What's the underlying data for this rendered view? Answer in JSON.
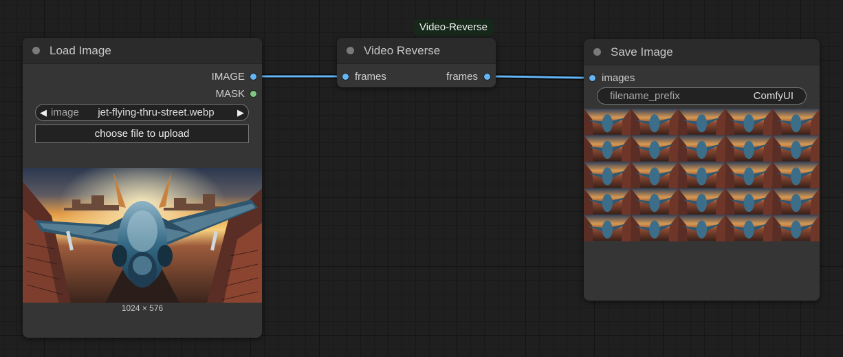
{
  "canvas": {
    "badge": "Video-Reverse"
  },
  "load_image": {
    "title": "Load Image",
    "outputs": [
      "IMAGE",
      "MASK"
    ],
    "image_widget": {
      "name": "image",
      "value": "jet-flying-thru-street.webp"
    },
    "upload_label": "choose file to upload",
    "dimensions": "1024 × 576"
  },
  "video_reverse": {
    "title": "Video Reverse",
    "input": "frames",
    "output": "frames"
  },
  "save_image": {
    "title": "Save Image",
    "input": "images",
    "filename_prefix": {
      "name": "filename_prefix",
      "value": "ComfyUI"
    },
    "frames": {
      "columns": 5,
      "rows": 5
    }
  },
  "colors": {
    "image_socket": "#64b5f6",
    "mask_socket": "#81c784",
    "link": "#64b5f6",
    "title_dot": "#7a7a7a"
  }
}
